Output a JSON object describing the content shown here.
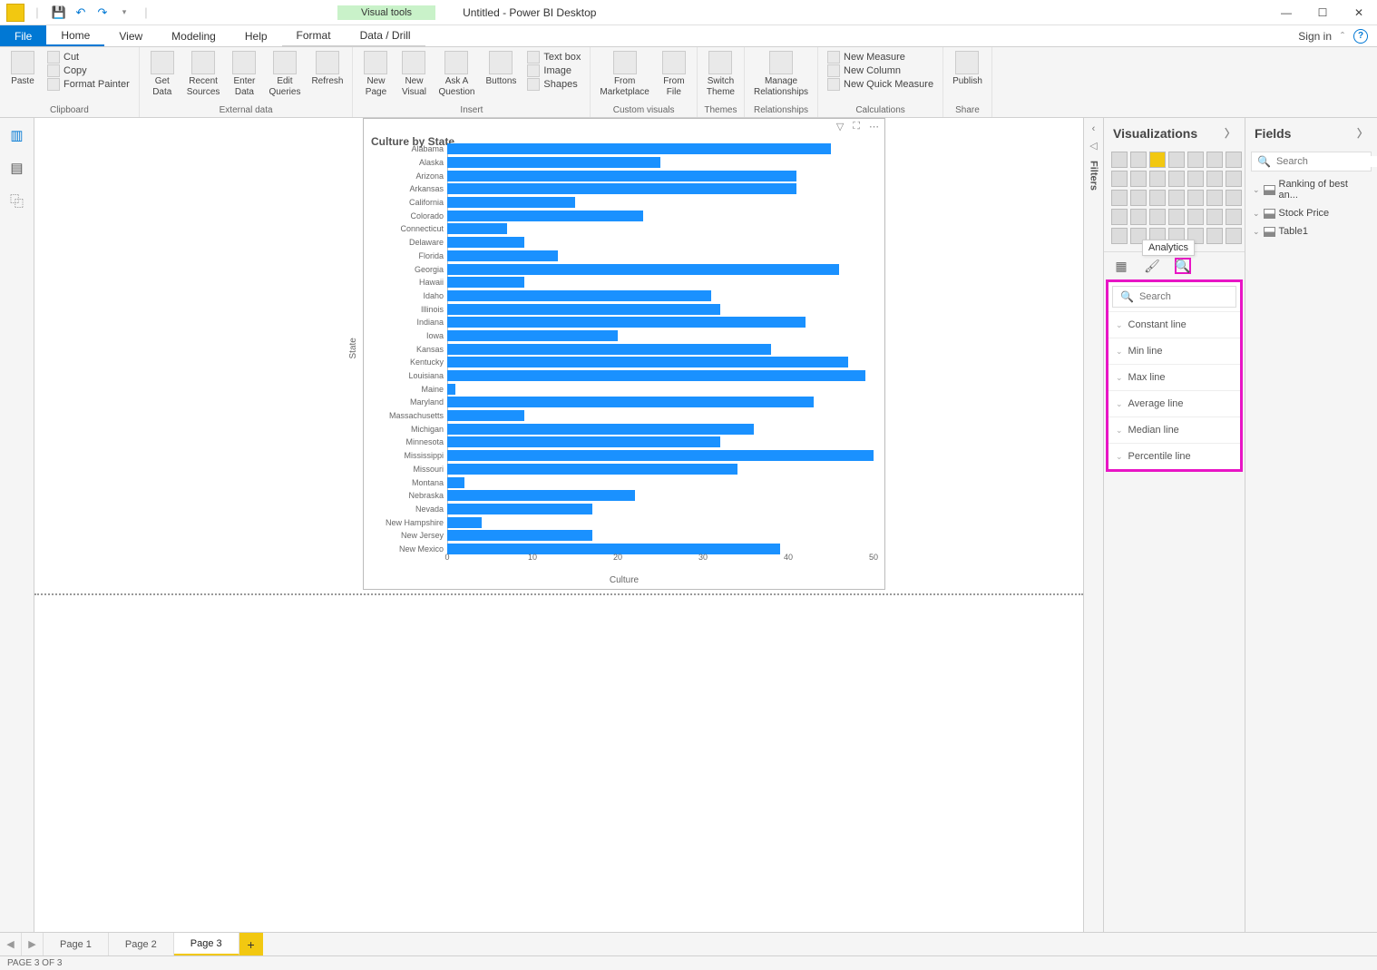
{
  "titlebar": {
    "app_title": "Untitled - Power BI Desktop",
    "visual_tools": "Visual tools"
  },
  "menu": {
    "file": "File",
    "home": "Home",
    "view": "View",
    "modeling": "Modeling",
    "help": "Help",
    "format": "Format",
    "datadrill": "Data / Drill",
    "signin": "Sign in"
  },
  "ribbon": {
    "clipboard": {
      "label": "Clipboard",
      "paste": "Paste",
      "cut": "Cut",
      "copy": "Copy",
      "fmt": "Format Painter"
    },
    "external": {
      "label": "External data",
      "getdata": "Get\nData",
      "recent": "Recent\nSources",
      "enter": "Enter\nData",
      "edit": "Edit\nQueries",
      "refresh": "Refresh"
    },
    "insert": {
      "label": "Insert",
      "newpage": "New\nPage",
      "newvisual": "New\nVisual",
      "ask": "Ask A\nQuestion",
      "buttons": "Buttons",
      "textbox": "Text box",
      "image": "Image",
      "shapes": "Shapes"
    },
    "custom": {
      "label": "Custom visuals",
      "market": "From\nMarketplace",
      "file": "From\nFile"
    },
    "themes": {
      "label": "Themes",
      "switch": "Switch\nTheme"
    },
    "rel": {
      "label": "Relationships",
      "manage": "Manage\nRelationships"
    },
    "calc": {
      "label": "Calculations",
      "measure": "New Measure",
      "column": "New Column",
      "quick": "New Quick Measure"
    },
    "share": {
      "label": "Share",
      "publish": "Publish"
    }
  },
  "visual": {
    "title": "Culture by State",
    "ylabel": "State",
    "xlabel": "Culture"
  },
  "chart_data": {
    "type": "bar",
    "title": "Culture by State",
    "xlabel": "Culture",
    "ylabel": "State",
    "xlim": [
      0,
      50
    ],
    "xticks": [
      0,
      10,
      20,
      30,
      40,
      50
    ],
    "categories": [
      "Alabama",
      "Alaska",
      "Arizona",
      "Arkansas",
      "California",
      "Colorado",
      "Connecticut",
      "Delaware",
      "Florida",
      "Georgia",
      "Hawaii",
      "Idaho",
      "Illinois",
      "Indiana",
      "Iowa",
      "Kansas",
      "Kentucky",
      "Louisiana",
      "Maine",
      "Maryland",
      "Massachusetts",
      "Michigan",
      "Minnesota",
      "Mississippi",
      "Missouri",
      "Montana",
      "Nebraska",
      "Nevada",
      "New Hampshire",
      "New Jersey",
      "New Mexico"
    ],
    "values": [
      45,
      25,
      41,
      41,
      15,
      23,
      7,
      9,
      13,
      46,
      9,
      31,
      32,
      42,
      20,
      38,
      47,
      49,
      1,
      43,
      9,
      36,
      32,
      50,
      34,
      2,
      22,
      17,
      4,
      17,
      39
    ]
  },
  "panes": {
    "filters_label": "Filters",
    "visualizations": "Visualizations",
    "fields": "Fields",
    "analytics_tooltip": "Analytics",
    "search_placeholder": "Search",
    "analytics_items": [
      "Constant line",
      "Min line",
      "Max line",
      "Average line",
      "Median line",
      "Percentile line"
    ]
  },
  "fields": {
    "search_placeholder": "Search",
    "tables": [
      "Ranking of best an...",
      "Stock Price",
      "Table1"
    ]
  },
  "pages": {
    "p1": "Page 1",
    "p2": "Page 2",
    "p3": "Page 3"
  },
  "status": "PAGE 3 OF 3"
}
